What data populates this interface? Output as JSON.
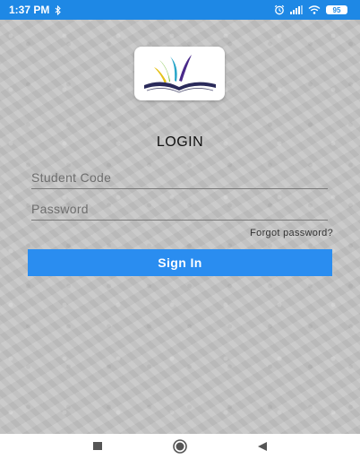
{
  "status_bar": {
    "time": "1:37 PM",
    "bluetooth_icon": "bluetooth-icon",
    "alarm_icon": "alarm-icon",
    "signal_icon": "signal-icon",
    "wifi_icon": "wifi-icon",
    "battery_level": "95"
  },
  "logo": {
    "icon": "open-book-logo-icon"
  },
  "login": {
    "title": "LOGIN",
    "student_code_placeholder": "Student Code",
    "student_code_value": "",
    "password_placeholder": "Password",
    "password_value": "",
    "forgot_password": "Forgot password?",
    "sign_in_label": "Sign In"
  },
  "nav_bar": {
    "recents_icon": "square-icon",
    "home_icon": "circle-icon",
    "back_icon": "triangle-back-icon"
  },
  "colors": {
    "status_bar": "#1e88e5",
    "primary_button": "#2a8df0",
    "background": "#c6c6c6"
  }
}
